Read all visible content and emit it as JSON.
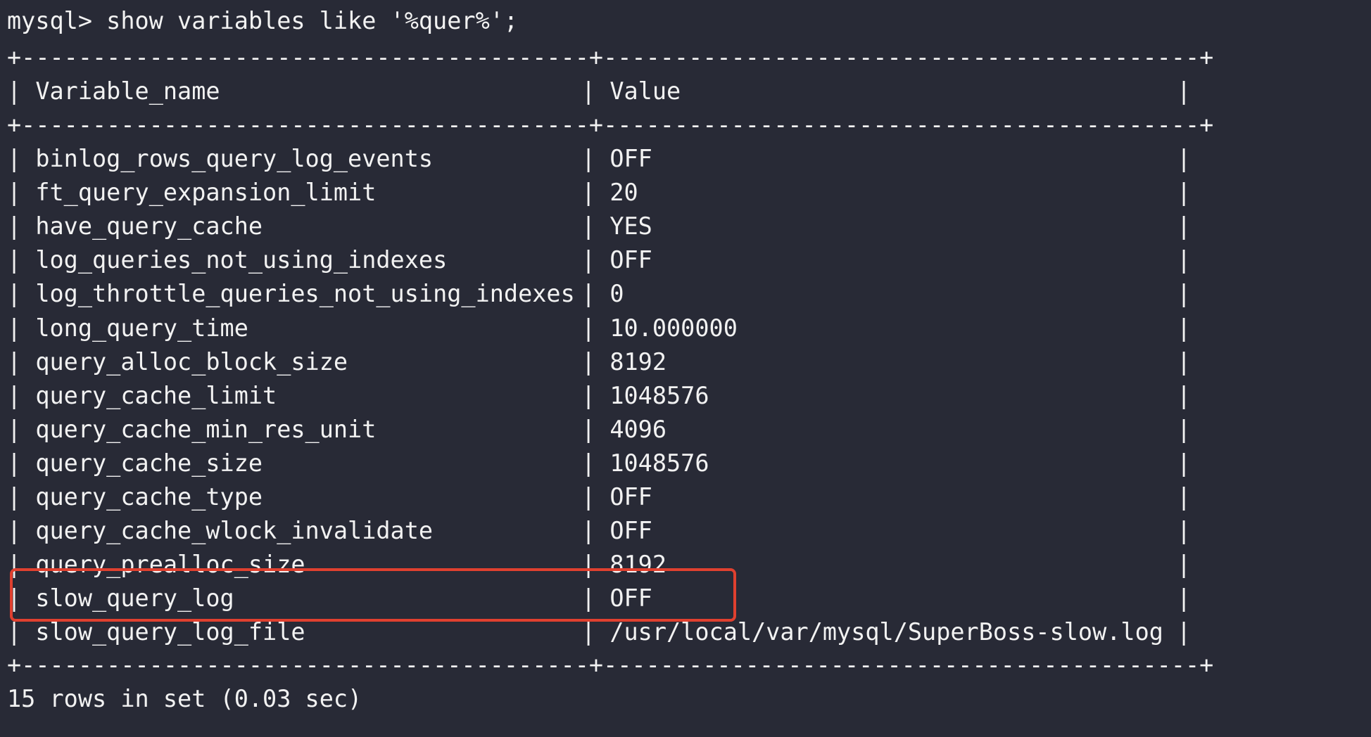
{
  "terminal": {
    "command_line": "mysql> show variables like '%quer%';",
    "border": "+----------------------------------------+------------------------------------------+",
    "header": {
      "col1": "Variable_name",
      "col2": "Value"
    },
    "rows": [
      {
        "name": "binlog_rows_query_log_events",
        "value": "OFF"
      },
      {
        "name": "ft_query_expansion_limit",
        "value": "20"
      },
      {
        "name": "have_query_cache",
        "value": "YES"
      },
      {
        "name": "log_queries_not_using_indexes",
        "value": "OFF"
      },
      {
        "name": "log_throttle_queries_not_using_indexes",
        "value": "0"
      },
      {
        "name": "long_query_time",
        "value": "10.000000"
      },
      {
        "name": "query_alloc_block_size",
        "value": "8192"
      },
      {
        "name": "query_cache_limit",
        "value": "1048576"
      },
      {
        "name": "query_cache_min_res_unit",
        "value": "4096"
      },
      {
        "name": "query_cache_size",
        "value": "1048576"
      },
      {
        "name": "query_cache_type",
        "value": "OFF"
      },
      {
        "name": "query_cache_wlock_invalidate",
        "value": "OFF"
      },
      {
        "name": "query_prealloc_size",
        "value": "8192"
      },
      {
        "name": "slow_query_log",
        "value": "OFF"
      },
      {
        "name": "slow_query_log_file",
        "value": "/usr/local/var/mysql/SuperBoss-slow.log"
      }
    ],
    "footer": "15 rows in set (0.03 sec)",
    "highlight_color": "#e0402f",
    "background_color": "#282a36",
    "text_color": "#f2f2f2"
  }
}
